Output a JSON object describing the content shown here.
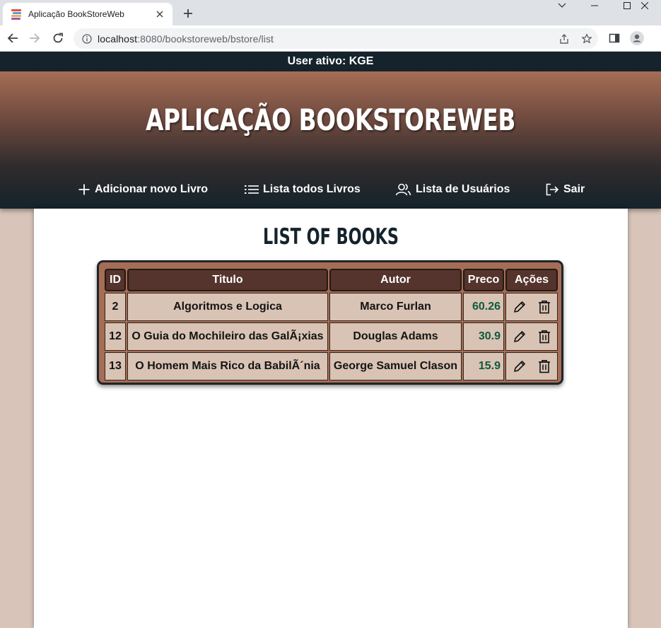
{
  "browser": {
    "tab_title": "Aplicação BookStoreWeb",
    "url_host": "localhost",
    "url_path": ":8080/bookstoreweb/bstore/list"
  },
  "userbar": {
    "text": "User ativo: KGE"
  },
  "header": {
    "title": "APLICAÇÃO BOOKSTOREWEB"
  },
  "nav": {
    "add": "Adicionar novo Livro",
    "list": "Lista todos Livros",
    "users": "Lista de Usuários",
    "logout": "Sair"
  },
  "main": {
    "title": "LIST OF BOOKS",
    "columns": [
      "ID",
      "Titulo",
      "Autor",
      "Preco",
      "Ações"
    ],
    "rows": [
      {
        "id": "2",
        "titulo": "Algoritmos e Logica",
        "autor": "Marco Furlan",
        "preco": "60.26"
      },
      {
        "id": "12",
        "titulo": "O Guia do Mochileiro das GalÃ¡xias",
        "autor": "Douglas Adams",
        "preco": "30.9"
      },
      {
        "id": "13",
        "titulo": "O Homem Mais Rico da BabilÃ´nia",
        "autor": "George Samuel Clason",
        "preco": "15.9"
      }
    ]
  },
  "colors": {
    "header_top": "#a56d55",
    "dark": "#15232c",
    "th_bg": "#54342c",
    "td_bg": "#d9c3b4",
    "price": "#0e5a3c",
    "page_bg": "#d8c4b8"
  },
  "icons": {
    "add": "plus-icon",
    "list": "list-icon",
    "users": "users-icon",
    "logout": "logout-icon",
    "edit": "pencil-icon",
    "delete": "trash-icon"
  }
}
